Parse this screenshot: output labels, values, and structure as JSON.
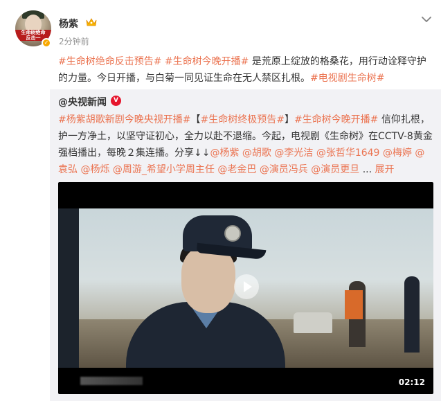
{
  "post": {
    "author": "杨紫",
    "time": "2分钟前",
    "segments": [
      {
        "type": "tag",
        "text": "#生命树绝命反击预告#"
      },
      {
        "type": "text",
        "text": " "
      },
      {
        "type": "tag",
        "text": "#生命树今晚开播#"
      },
      {
        "type": "text",
        "text": " 是荒原上绽放的格桑花，用行动诠释守护的力量。今日开播，与白菊一同见证生命在无人禁区扎根。"
      },
      {
        "type": "tag",
        "text": "#电视剧生命树#"
      }
    ]
  },
  "avatar": {
    "banner_line1": "生命树绝命",
    "banner_line2": "反击一"
  },
  "repost": {
    "author": "@央视新闻",
    "verified_label": "V",
    "segments": [
      {
        "type": "tag",
        "text": "#杨紫胡歌新剧今晚央视开播#"
      },
      {
        "type": "text",
        "text": "【"
      },
      {
        "type": "tag",
        "text": "#生命树终极预告#"
      },
      {
        "type": "text",
        "text": "】"
      },
      {
        "type": "tag",
        "text": "#生命树今晚开播#"
      },
      {
        "type": "text",
        "text": " 信仰扎根，护一方净土，以坚守证初心，全力以赴不退缩。今起，电视剧《生命树》在CCTV-8黄金强档播出，每晚２集连播。分享↓↓"
      },
      {
        "type": "tag",
        "text": "@杨紫"
      },
      {
        "type": "text",
        "text": " "
      },
      {
        "type": "tag",
        "text": "@胡歌"
      },
      {
        "type": "text",
        "text": " "
      },
      {
        "type": "tag",
        "text": "@李光洁"
      },
      {
        "type": "text",
        "text": " "
      },
      {
        "type": "tag",
        "text": "@张哲华1649"
      },
      {
        "type": "text",
        "text": " "
      },
      {
        "type": "tag",
        "text": "@梅婷"
      },
      {
        "type": "text",
        "text": " "
      },
      {
        "type": "tag",
        "text": "@袁弘"
      },
      {
        "type": "text",
        "text": " "
      },
      {
        "type": "tag",
        "text": "@杨烁"
      },
      {
        "type": "text",
        "text": " "
      },
      {
        "type": "tag",
        "text": "@周游_希望小学周主任"
      },
      {
        "type": "text",
        "text": " "
      },
      {
        "type": "tag",
        "text": "@老金巴"
      },
      {
        "type": "text",
        "text": " "
      },
      {
        "type": "tag",
        "text": "@演员冯兵"
      },
      {
        "type": "text",
        "text": " "
      },
      {
        "type": "tag",
        "text": "@演员更旦"
      },
      {
        "type": "text",
        "text": " ... "
      },
      {
        "type": "tag",
        "text": "展开"
      }
    ]
  },
  "video": {
    "duration": "02:12"
  },
  "colors": {
    "accent": "#eb7350",
    "repost_bg": "#f2f2f5",
    "verified": "#e6162d"
  },
  "icons": [
    "vip-crown-icon",
    "chevron-down-icon",
    "verified-v-icon",
    "play-icon"
  ]
}
